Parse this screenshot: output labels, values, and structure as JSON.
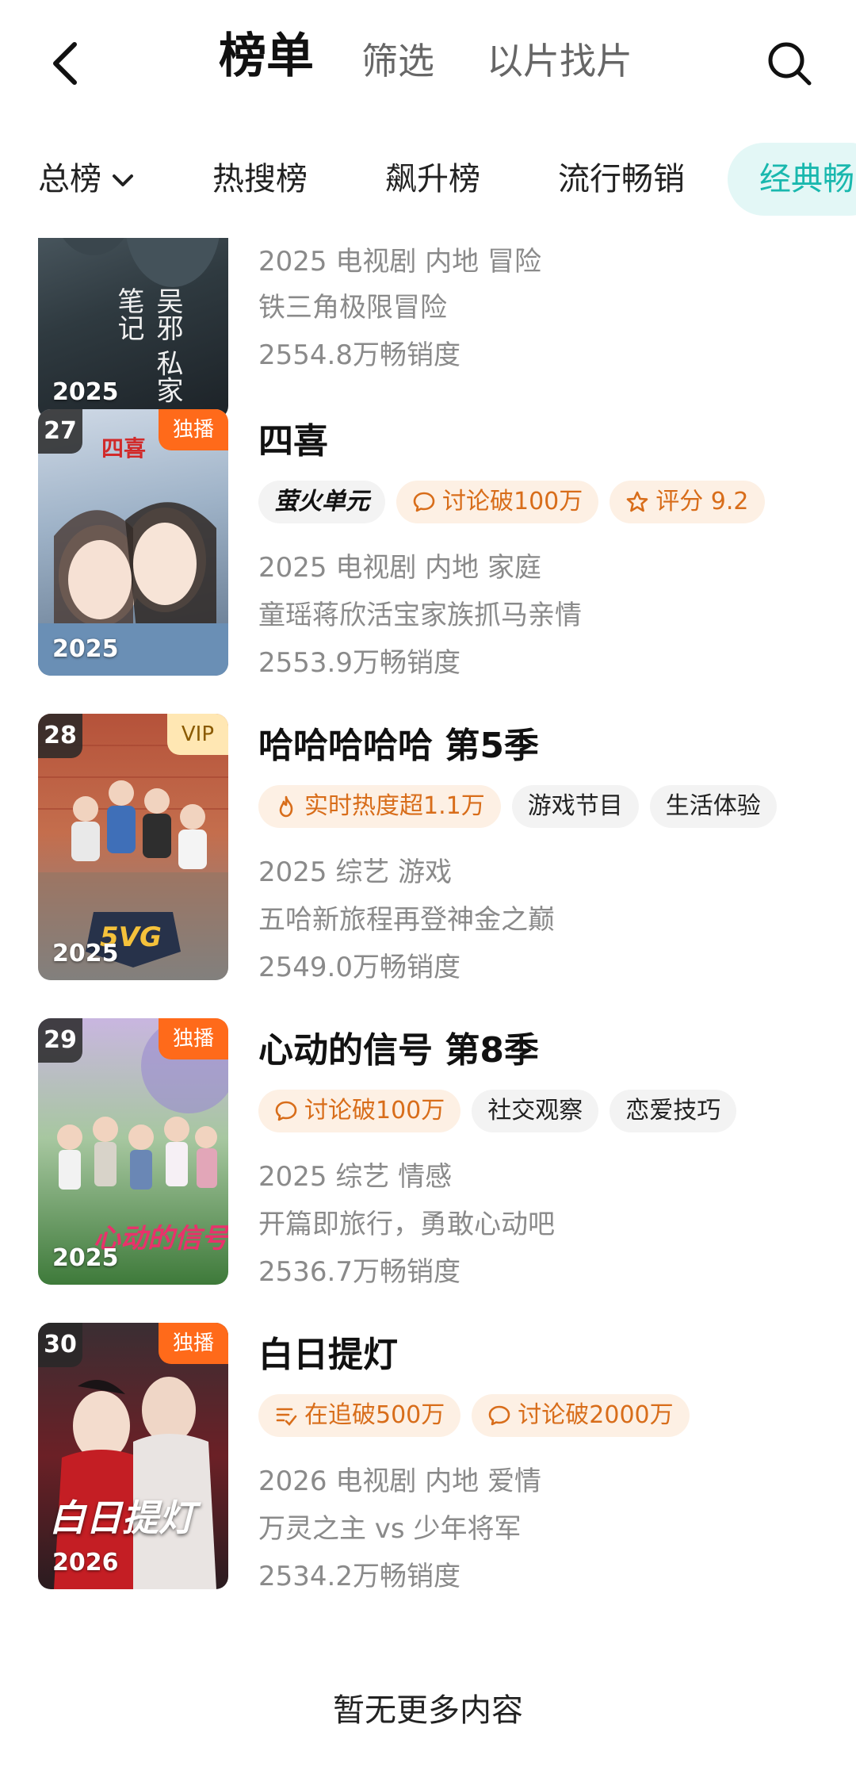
{
  "header": {
    "tabs": [
      {
        "label": "榜单",
        "active": true
      },
      {
        "label": "筛选",
        "active": false
      },
      {
        "label": "以片找片",
        "active": false
      }
    ],
    "back_icon": "chevron-left-icon",
    "search_icon": "search-icon"
  },
  "subtabs": [
    {
      "label": "总榜",
      "dropdown": true
    },
    {
      "label": "热搜榜"
    },
    {
      "label": "飙升榜"
    },
    {
      "label": "流行畅销"
    },
    {
      "label": "经典畅",
      "selected": true
    }
  ],
  "items": [
    {
      "rank": "",
      "flag": "",
      "year": "2025",
      "poster_text": "吴邪 私家笔记",
      "title": "",
      "tags": [],
      "meta1": "2025 电视剧 内地 冒险",
      "meta2": "铁三角极限冒险",
      "meta3": "2554.8万畅销度"
    },
    {
      "rank": "27",
      "flag": "独播",
      "year": "2025",
      "poster_text": "四喜",
      "title": "四喜",
      "tags": [
        {
          "text": "萤火单元",
          "style": "brand",
          "icon": ""
        },
        {
          "text": "讨论破100万",
          "style": "hot",
          "icon": "chat-bubble-icon"
        },
        {
          "text": "评分 9.2",
          "style": "hot",
          "icon": "star-icon"
        }
      ],
      "meta1": "2025 电视剧 内地 家庭",
      "meta2": "童瑶蒋欣活宝家族抓马亲情",
      "meta3": "2553.9万畅销度"
    },
    {
      "rank": "28",
      "flag": "VIP",
      "year": "2025",
      "poster_text": "5VG",
      "title": "哈哈哈哈哈 第5季",
      "tags": [
        {
          "text": "实时热度超1.1万",
          "style": "hot",
          "icon": "flame-icon"
        },
        {
          "text": "游戏节目",
          "style": "plain",
          "icon": ""
        },
        {
          "text": "生活体验",
          "style": "plain",
          "icon": ""
        }
      ],
      "meta1": "2025 综艺 游戏",
      "meta2": "五哈新旅程再登神金之巅",
      "meta3": "2549.0万畅销度"
    },
    {
      "rank": "29",
      "flag": "独播",
      "year": "2025",
      "poster_text": "心动的信号",
      "title": "心动的信号 第8季",
      "tags": [
        {
          "text": "讨论破100万",
          "style": "hot",
          "icon": "chat-bubble-icon"
        },
        {
          "text": "社交观察",
          "style": "plain",
          "icon": ""
        },
        {
          "text": "恋爱技巧",
          "style": "plain",
          "icon": ""
        }
      ],
      "meta1": "2025 综艺 情感",
      "meta2": "开篇即旅行，勇敢心动吧",
      "meta3": "2536.7万畅销度"
    },
    {
      "rank": "30",
      "flag": "独播",
      "year": "2026",
      "poster_text": "白日提灯",
      "title": "白日提灯",
      "tags": [
        {
          "text": "在追破500万",
          "style": "hot",
          "icon": "watchlist-icon"
        },
        {
          "text": "讨论破2000万",
          "style": "hot",
          "icon": "chat-bubble-icon"
        }
      ],
      "meta1": "2026 电视剧 内地 爱情",
      "meta2": "万灵之主 vs 少年将军",
      "meta3": "2534.2万畅销度"
    }
  ],
  "footer": {
    "text": "暂无更多内容"
  },
  "colors": {
    "accent": "#19b8ae",
    "hot_tag_bg": "#fdf0e4",
    "hot_tag_fg": "#d86d1a",
    "exclusive": "#ff6a1a"
  }
}
